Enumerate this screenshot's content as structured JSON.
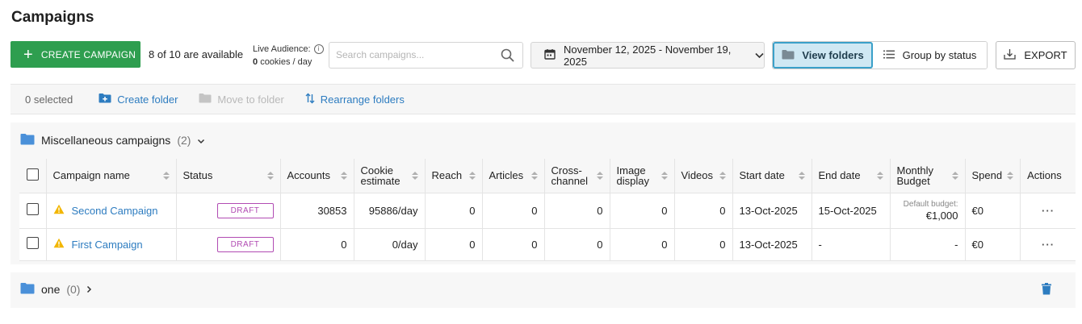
{
  "page": {
    "title": "Campaigns"
  },
  "toolbar": {
    "create_label": "CREATE CAMPAIGN",
    "availability": "8 of 10 are available",
    "live_audience_label": "Live Audience:",
    "live_audience_count": "0",
    "live_audience_unit": "cookies / day",
    "search_placeholder": "Search campaigns...",
    "date_range": "November 12, 2025 - November 19, 2025",
    "view_folders_label": "View folders",
    "group_by_status_label": "Group by status",
    "export_label": "EXPORT"
  },
  "selection_bar": {
    "selected": "0 selected",
    "create_folder": "Create folder",
    "move_to_folder": "Move to folder",
    "rearrange_folders": "Rearrange folders"
  },
  "folders": [
    {
      "name": "Miscellaneous campaigns",
      "count": "(2)"
    },
    {
      "name": "one",
      "count": "(0)"
    }
  ],
  "table": {
    "columns": [
      {
        "label": "Campaign name",
        "sortable": true
      },
      {
        "label": "Status",
        "sortable": true
      },
      {
        "label": "Accounts",
        "sortable": true
      },
      {
        "label": "Cookie estimate",
        "sortable": true
      },
      {
        "label": "Reach",
        "sortable": true
      },
      {
        "label": "Articles",
        "sortable": true
      },
      {
        "label": "Cross-channel",
        "sortable": true
      },
      {
        "label": "Image display",
        "sortable": true
      },
      {
        "label": "Videos",
        "sortable": true
      },
      {
        "label": "Start date",
        "sortable": true
      },
      {
        "label": "End date",
        "sortable": true
      },
      {
        "label": "Monthly Budget",
        "sortable": true
      },
      {
        "label": "Spend",
        "sortable": true
      },
      {
        "label": "Actions",
        "sortable": false
      }
    ],
    "rows": [
      {
        "name": "Second Campaign",
        "status": "DRAFT",
        "accounts": "30853",
        "cookie_estimate": "95886/day",
        "reach": "0",
        "articles": "0",
        "cross_channel": "0",
        "image_display": "0",
        "videos": "0",
        "start_date": "13-Oct-2025",
        "end_date": "15-Oct-2025",
        "budget_note": "Default budget:",
        "budget": "€1,000",
        "spend": "€0",
        "actions": "···"
      },
      {
        "name": "First Campaign",
        "status": "DRAFT",
        "accounts": "0",
        "cookie_estimate": "0/day",
        "reach": "0",
        "articles": "0",
        "cross_channel": "0",
        "image_display": "0",
        "videos": "0",
        "start_date": "13-Oct-2025",
        "end_date": "-",
        "budget_note": "",
        "budget": "-",
        "spend": "€0",
        "actions": "···"
      }
    ]
  },
  "colors": {
    "primary_green": "#2e9e4f",
    "link_blue": "#2d7cc0",
    "draft_purple": "#b14bb3",
    "warning_yellow": "#f2b600",
    "folder_blue": "#4a90d9",
    "active_segment_bg": "#cfe8f3"
  },
  "icons": {
    "create": "plus-icon",
    "info": "info-icon",
    "search": "search-icon",
    "calendar": "calendar-icon",
    "folder": "folder-icon",
    "list": "list-icon",
    "export": "download-icon",
    "warning": "warning-icon",
    "trash": "trash-icon"
  }
}
